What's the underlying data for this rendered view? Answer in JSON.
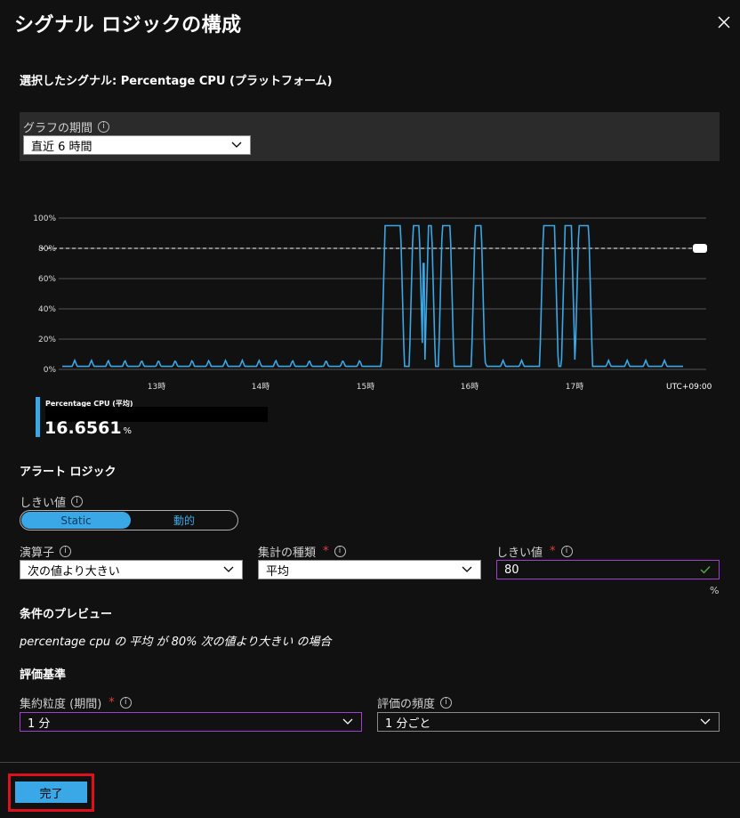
{
  "title": "シグナル ロジックの構成",
  "selected_signal": "選択したシグナル: Percentage CPU (プラットフォーム)",
  "graph_period": {
    "label": "グラフの期間",
    "value": "直近 6 時間"
  },
  "chart_data": {
    "type": "line",
    "title": "",
    "xlabel": "",
    "ylabel": "",
    "y_ticks": [
      "100%",
      "80%",
      "60%",
      "40%",
      "20%",
      "0%"
    ],
    "ylim": [
      0,
      100
    ],
    "x_ticks": [
      "13時",
      "14時",
      "15時",
      "16時",
      "17時"
    ],
    "timezone_label": "UTC+09:00",
    "threshold": 80,
    "series": [
      {
        "name": "Percentage CPU (平均)",
        "x": [
          0.0,
          0.01,
          0.02,
          0.03,
          0.04,
          0.05,
          0.06,
          0.07,
          0.08,
          0.09,
          0.1,
          0.11,
          0.12,
          0.13,
          0.14,
          0.15,
          0.16,
          0.17,
          0.18,
          0.19,
          0.2,
          0.21,
          0.22,
          0.23,
          0.24,
          0.25,
          0.26,
          0.27,
          0.28,
          0.29,
          0.3,
          0.31,
          0.32,
          0.33,
          0.34,
          0.35,
          0.36,
          0.37,
          0.38,
          0.39,
          0.4,
          0.41,
          0.42,
          0.43,
          0.44,
          0.45,
          0.46,
          0.47,
          0.48,
          0.49,
          0.5,
          0.51,
          0.52,
          0.53,
          0.54,
          0.55,
          0.56,
          0.57,
          0.58,
          0.59,
          0.6,
          0.61,
          0.62,
          0.63,
          0.64,
          0.65,
          0.66,
          0.67,
          0.68,
          0.69,
          0.7,
          0.71,
          0.72,
          0.73,
          0.74,
          0.75,
          0.76,
          0.77,
          0.78,
          0.79,
          0.8,
          0.81,
          0.82,
          0.83,
          0.84,
          0.85,
          0.86,
          0.87,
          0.88,
          0.89,
          0.9,
          0.91,
          0.92,
          0.93,
          0.94,
          0.95,
          0.96,
          0.97,
          0.98,
          0.99,
          1.0
        ],
        "values": [
          1,
          1,
          1,
          1,
          1,
          1,
          1,
          1,
          1,
          1,
          1,
          1,
          1,
          1,
          1,
          1,
          1,
          1,
          1,
          1,
          1,
          1,
          1,
          1,
          1,
          1,
          1,
          1,
          1,
          1,
          1,
          1,
          1,
          1,
          1,
          1,
          1,
          1,
          1,
          1,
          1,
          1,
          1,
          1,
          1,
          1,
          1,
          1,
          1,
          1,
          1,
          1,
          1,
          1,
          1,
          1,
          1,
          1,
          1,
          1,
          1,
          1,
          1,
          1,
          1,
          1,
          1,
          1,
          1,
          1,
          1,
          1,
          1,
          1,
          1,
          1,
          1,
          1,
          1,
          1,
          1,
          1,
          1,
          1,
          1,
          1,
          1,
          1,
          1,
          1,
          1,
          1,
          1,
          1,
          1,
          1,
          1,
          1,
          1,
          1,
          1
        ]
      }
    ]
  },
  "legend": {
    "name": "Percentage CPU (平均)",
    "value": "16.6561",
    "unit": "%"
  },
  "alert_logic": {
    "heading": "アラート ロジック",
    "threshold_type_label": "しきい値",
    "toggle": {
      "static": "Static",
      "dynamic": "動的"
    },
    "operator": {
      "label": "演算子",
      "value": "次の値より大きい"
    },
    "aggregation": {
      "label": "集計の種類",
      "value": "平均"
    },
    "threshold": {
      "label": "しきい値",
      "value": "80",
      "unit": "%"
    }
  },
  "preview": {
    "heading": "条件のプレビュー",
    "text": "percentage cpu の 平均 が 80% 次の値より大きい の場合"
  },
  "evaluation": {
    "heading": "評価基準",
    "granularity": {
      "label": "集約粒度 (期間)",
      "value": "1 分"
    },
    "frequency": {
      "label": "評価の頻度",
      "value": "1 分ごと"
    }
  },
  "done_button": "完了",
  "colors": {
    "accent": "#3aa8e6",
    "background": "#111111",
    "highlight": "#e0101a"
  }
}
